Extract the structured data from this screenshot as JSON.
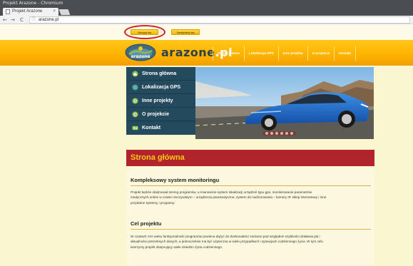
{
  "window": {
    "title": "Projekt Arazone - Chromium"
  },
  "tab": {
    "label": "Projekt Arazone",
    "close_glyph": "×"
  },
  "addressbar": {
    "back": "←",
    "forward": "→",
    "reload": "C",
    "info_glyph": "ⓘ",
    "url": "arazone.pl"
  },
  "topbar": {
    "login_label": "Zaloguj się",
    "register_label": "Zarejestruj się"
  },
  "header": {
    "brand_main": "arazone",
    "brand_tld": ".pl",
    "logo_label": "arazone",
    "nav": [
      "Strona główna",
      "Lokalizacja GPS",
      "Inne projekty",
      "O projekcie",
      "Kontakt"
    ]
  },
  "sidebar": {
    "items": [
      {
        "label": "Strona główna",
        "icon": "home-icon"
      },
      {
        "label": "Lokalizacja GPS",
        "icon": "globe-icon"
      },
      {
        "label": "Inne projekty",
        "icon": "eye-icon"
      },
      {
        "label": "O projekcie",
        "icon": "eye-icon"
      },
      {
        "label": "Kontakt",
        "icon": "contact-icon"
      }
    ]
  },
  "slider": {
    "dot_count": 6,
    "image": "blue-car-photo"
  },
  "main": {
    "title": "Strona główna",
    "sections": [
      {
        "heading": "Kompleksowy system monitoringu",
        "lines": [
          "Projekt będzie obejmował szereg programów, a mianowicie system lokalizacji urządzeń typu gps, monitorowanie parametrów",
          "medycznych online w czasie rzeczywistym – urządzenia paramedyczne, system do nadzorowania – kamery IP, sklep internetowy i inne",
          "przydatne systemy i programy."
        ]
      },
      {
        "heading": "Cel projektu",
        "lines": [
          "W czasach XXI wieku funkcjonalność programów powinna dążyć do doskonałości zarówno pod względem szybkości działania jak i",
          "aktualności potrzebnych danych, a jednocześnie ma być użyteczna w wielu przypadkach i sytuacjach codziennego życia. W tym celu",
          "tworzymy projekt obejmujący wiele dziedzin życia codziennego."
        ]
      }
    ]
  },
  "colors": {
    "accent": "#ffb400",
    "sidebar": "#244a5e",
    "title_bar": "#b1252a",
    "title_text": "#f7c71a",
    "page_bg": "#faf6cf",
    "annotation": "#d62020"
  }
}
